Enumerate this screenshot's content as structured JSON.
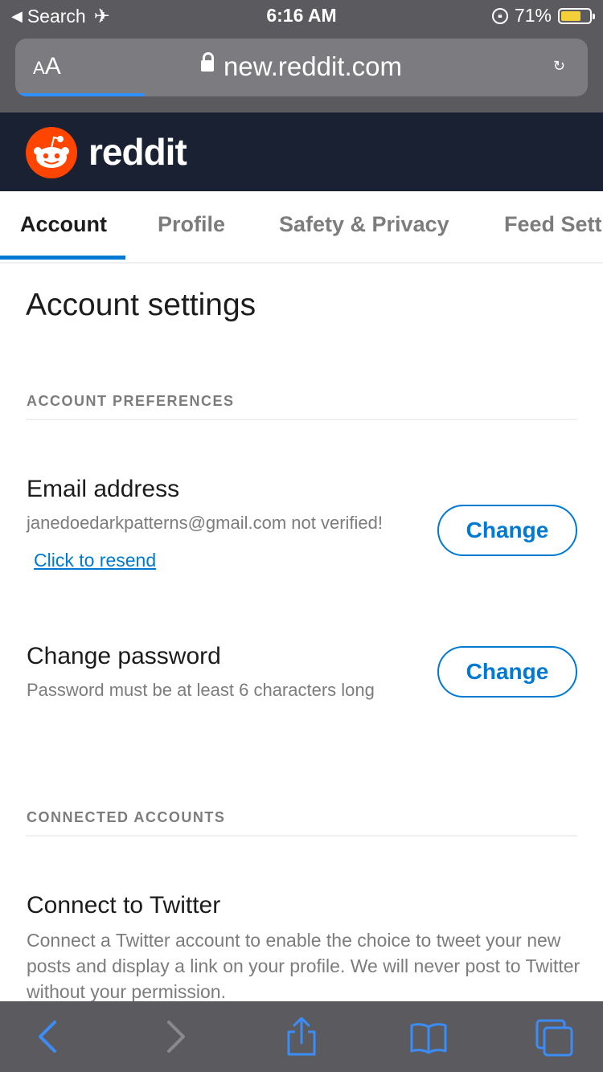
{
  "status_bar": {
    "back_label": "Search",
    "time": "6:16 AM",
    "battery_percent": "71%",
    "battery_level": 0.71
  },
  "browser": {
    "text_size_label": "AA",
    "url": "new.reddit.com",
    "load_progress": 0.22
  },
  "site": {
    "brand": "reddit",
    "accent_color": "#0079d3",
    "brand_color": "#ff4500"
  },
  "tabs": [
    {
      "label": "Account",
      "active": true
    },
    {
      "label": "Profile",
      "active": false
    },
    {
      "label": "Safety & Privacy",
      "active": false
    },
    {
      "label": "Feed Sett",
      "active": false
    }
  ],
  "page_title": "Account settings",
  "sections": {
    "preferences": {
      "label": "ACCOUNT PREFERENCES",
      "email": {
        "title": "Email address",
        "value": "janedoedarkpatterns@gmail.com not verified!",
        "resend_label": "Click to resend",
        "button_label": "Change"
      },
      "password": {
        "title": "Change password",
        "hint": "Password must be at least 6 characters long",
        "button_label": "Change"
      }
    },
    "connected": {
      "label": "CONNECTED ACCOUNTS",
      "twitter": {
        "title": "Connect to Twitter",
        "description": "Connect a Twitter account to enable the choice to tweet your new posts and display a link on your profile. We will never post to Twitter without your permission."
      }
    }
  },
  "toolbar_icons": [
    "back-icon",
    "forward-icon",
    "share-icon",
    "bookmarks-icon",
    "tabs-icon"
  ]
}
